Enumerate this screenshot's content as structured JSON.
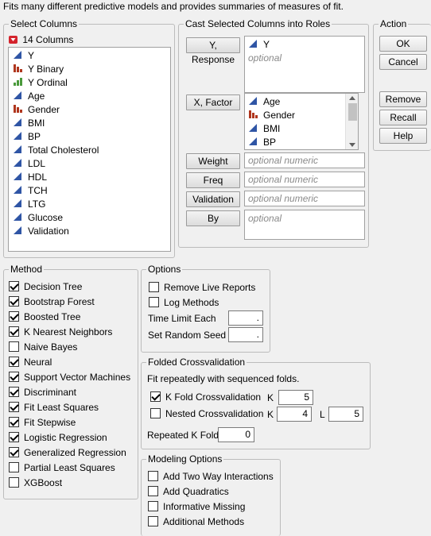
{
  "header": {
    "description": "Fits many different predictive models and provides summaries of measures of fit."
  },
  "select_columns": {
    "title": "Select Columns",
    "count_label": "14 Columns",
    "columns": [
      {
        "name": "Y",
        "type": "continuous"
      },
      {
        "name": "Y Binary",
        "type": "nominal"
      },
      {
        "name": "Y Ordinal",
        "type": "ordinal"
      },
      {
        "name": "Age",
        "type": "continuous"
      },
      {
        "name": "Gender",
        "type": "nominal"
      },
      {
        "name": "BMI",
        "type": "continuous"
      },
      {
        "name": "BP",
        "type": "continuous"
      },
      {
        "name": "Total Cholesterol",
        "type": "continuous"
      },
      {
        "name": "LDL",
        "type": "continuous"
      },
      {
        "name": "HDL",
        "type": "continuous"
      },
      {
        "name": "TCH",
        "type": "continuous"
      },
      {
        "name": "LTG",
        "type": "continuous"
      },
      {
        "name": "Glucose",
        "type": "continuous"
      },
      {
        "name": "Validation",
        "type": "continuous"
      }
    ]
  },
  "cast_roles": {
    "title": "Cast Selected Columns into Roles",
    "y_response": {
      "label": "Y, Response",
      "items": [
        {
          "name": "Y",
          "type": "continuous"
        }
      ],
      "placeholder": "optional"
    },
    "x_factor": {
      "label": "X, Factor",
      "items": [
        {
          "name": "Age",
          "type": "continuous"
        },
        {
          "name": "Gender",
          "type": "nominal"
        },
        {
          "name": "BMI",
          "type": "continuous"
        },
        {
          "name": "BP",
          "type": "continuous"
        }
      ]
    },
    "weight": {
      "label": "Weight",
      "placeholder": "optional numeric"
    },
    "freq": {
      "label": "Freq",
      "placeholder": "optional numeric"
    },
    "validation": {
      "label": "Validation",
      "placeholder": "optional numeric"
    },
    "by": {
      "label": "By",
      "placeholder": "optional"
    }
  },
  "action": {
    "title": "Action",
    "ok": "OK",
    "cancel": "Cancel",
    "remove": "Remove",
    "recall": "Recall",
    "help": "Help"
  },
  "method": {
    "title": "Method",
    "items": [
      {
        "label": "Decision Tree",
        "checked": true
      },
      {
        "label": "Bootstrap Forest",
        "checked": true
      },
      {
        "label": "Boosted Tree",
        "checked": true
      },
      {
        "label": "K Nearest Neighbors",
        "checked": true
      },
      {
        "label": "Naive Bayes",
        "checked": false
      },
      {
        "label": "Neural",
        "checked": true
      },
      {
        "label": "Support Vector Machines",
        "checked": true
      },
      {
        "label": "Discriminant",
        "checked": true
      },
      {
        "label": "Fit Least Squares",
        "checked": true
      },
      {
        "label": "Fit Stepwise",
        "checked": true
      },
      {
        "label": "Logistic Regression",
        "checked": true
      },
      {
        "label": "Generalized Regression",
        "checked": true
      },
      {
        "label": "Partial Least Squares",
        "checked": false
      },
      {
        "label": "XGBoost",
        "checked": false
      }
    ]
  },
  "options": {
    "title": "Options",
    "remove_live_reports": {
      "label": "Remove Live Reports",
      "checked": false
    },
    "log_methods": {
      "label": "Log Methods",
      "checked": false
    },
    "time_limit_label": "Time Limit Each",
    "time_limit_value": ".",
    "random_seed_label": "Set Random Seed",
    "random_seed_value": "."
  },
  "folded_cv": {
    "title": "Folded Crossvalidation",
    "description": "Fit repeatedly with sequenced folds.",
    "k_fold": {
      "label": "K Fold Crossvalidation",
      "checked": true,
      "k_label": "K",
      "k_value": "5"
    },
    "nested": {
      "label": "Nested Crossvalidation",
      "checked": false,
      "k_label": "K",
      "k_value": "4",
      "l_label": "L",
      "l_value": "5"
    },
    "repeated_label": "Repeated K Fold",
    "repeated_value": "0"
  },
  "modeling_options": {
    "title": "Modeling Options",
    "items": [
      {
        "label": "Add Two Way Interactions",
        "checked": false
      },
      {
        "label": "Add Quadratics",
        "checked": false
      },
      {
        "label": "Informative Missing",
        "checked": false
      },
      {
        "label": "Additional Methods",
        "checked": false
      }
    ]
  },
  "colors": {
    "continuous": "#2f55a5",
    "nominal": "#b0361e",
    "ordinal": "#4a9a3b",
    "dropdown_red": "#d4242d"
  }
}
